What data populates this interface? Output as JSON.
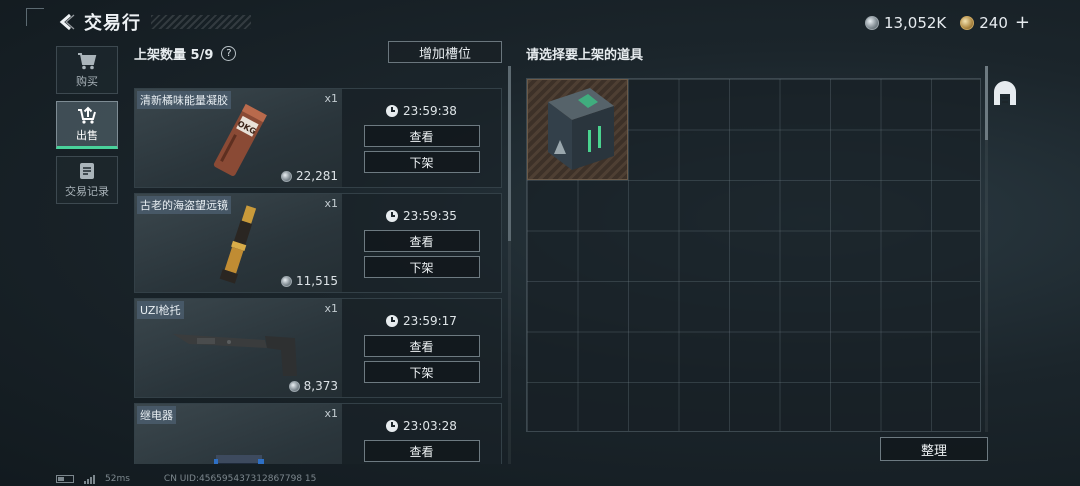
{
  "header": {
    "title": "交易行",
    "silver": "13,052K",
    "gold": "240"
  },
  "tabs": [
    {
      "label": "购买",
      "icon": "cart-icon"
    },
    {
      "label": "出售",
      "icon": "sell-icon"
    },
    {
      "label": "交易记录",
      "icon": "record-icon"
    }
  ],
  "listings": {
    "title": "上架数量 5/9",
    "help": "?",
    "add_slot": "增加槽位",
    "items": [
      {
        "name": "清新橘味能量凝胶",
        "qty": "x1",
        "price": "22,281",
        "timer": "23:59:38",
        "view": "查看",
        "unlist": "下架",
        "art_text": "OKG"
      },
      {
        "name": "古老的海盗望远镜",
        "qty": "x1",
        "price": "11,515",
        "timer": "23:59:35",
        "view": "查看",
        "unlist": "下架"
      },
      {
        "name": "UZI枪托",
        "qty": "x1",
        "price": "8,373",
        "timer": "23:59:17",
        "view": "查看",
        "unlist": "下架"
      },
      {
        "name": "继电器",
        "qty": "x1",
        "price": "",
        "timer": "23:03:28",
        "view": "查看",
        "unlist": ""
      }
    ]
  },
  "inventory": {
    "title": "请选择要上架的道具",
    "sort": "整理"
  },
  "status": {
    "ping": "52ms",
    "uid": "CN UID:456595437312867798 15"
  },
  "colors": {
    "accent": "#49d29b"
  }
}
